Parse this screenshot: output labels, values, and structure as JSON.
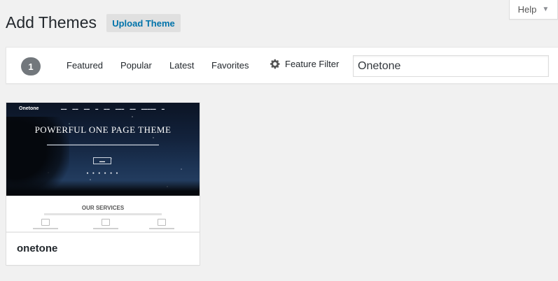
{
  "help": {
    "label": "Help",
    "caret": "▼"
  },
  "header": {
    "title": "Add Themes",
    "upload_label": "Upload Theme"
  },
  "filter_bar": {
    "count": "1",
    "links": {
      "featured": "Featured",
      "popular": "Popular",
      "latest": "Latest",
      "favorites": "Favorites"
    },
    "feature_filter_label": "Feature Filter",
    "search": {
      "value": "Onetone",
      "placeholder": ""
    }
  },
  "theme": {
    "name": "onetone",
    "preview": {
      "logo": "Onetone",
      "hero_title": "POWERFUL ONE PAGE THEME",
      "services_title": "OUR SERVICES"
    }
  },
  "colors": {
    "accent": "#0073aa",
    "badge": "#72777c",
    "background": "#f1f1f1"
  }
}
